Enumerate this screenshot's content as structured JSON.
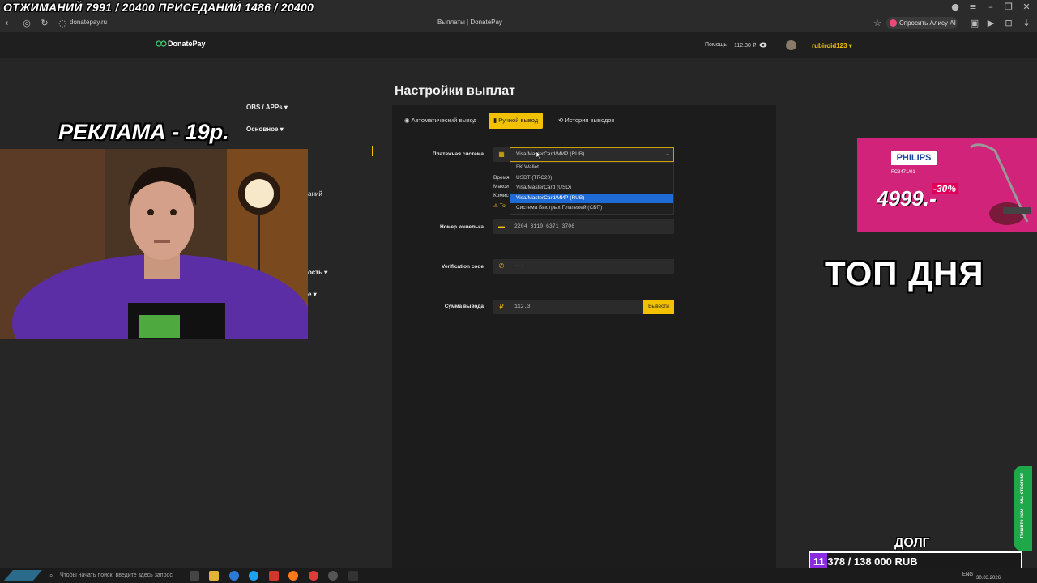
{
  "overlay": {
    "challenge": "ОТЖИМАНИЙ 7991 / 20400  ПРИСЕДАНИЙ 1486 / 20400",
    "ad_banner": "РЕКЛАМА - 19р.",
    "top_day": "ТОП ДНЯ",
    "debt_label": "ДОЛГ",
    "debt_progress": "11 378 / 138 000 RUB",
    "debt_fraction": 0.0825,
    "chat_tab": "Пишите нам – мы ответим!"
  },
  "browser": {
    "url": "donatepay.ru",
    "page_title": "Выплаты | DonatePay",
    "alice_label": "Спросить Алису AI"
  },
  "header": {
    "logo": "DonatePay",
    "help": "Помощь",
    "balance": "112.30 ₽",
    "username": "rubiroid123"
  },
  "sidebar": {
    "items": [
      "OBS / APPs",
      "Основное",
      "аний",
      "ость",
      "е"
    ]
  },
  "main": {
    "title": "Настройки выплат",
    "tabs": [
      "Автоматический вывод",
      "Ручной вывод",
      "История выводов"
    ],
    "payment_system_label": "Платежная система",
    "payment_system_value": "Visa/MasterCard/МИР (RUB)",
    "payment_options": [
      "FK Wallet",
      "USDT (TRC20)",
      "Visa/MasterCard (USD)",
      "Visa/MasterCard/МИР (RUB)",
      "Система Быстрых Платежей (СБП)"
    ],
    "hidden_rows": [
      "Время",
      "Макси",
      "Комис",
      "То"
    ],
    "wallet_label": "Номер кошелька",
    "wallet_value": "2204 3110 6371 3706",
    "verification_label": "Verification code",
    "verification_placeholder": "···",
    "amount_label": "Сумма вывода",
    "amount_value": "112.3",
    "withdraw_button": "Вывести"
  },
  "promo": {
    "brand": "PHILIPS",
    "model": "FC8471/01",
    "price": "4999.-",
    "discount": "-30%"
  },
  "taskbar": {
    "search_placeholder": "Чтобы начать поиск, введите здесь запрос",
    "lang": "ENG",
    "date": "30.03.2026"
  }
}
